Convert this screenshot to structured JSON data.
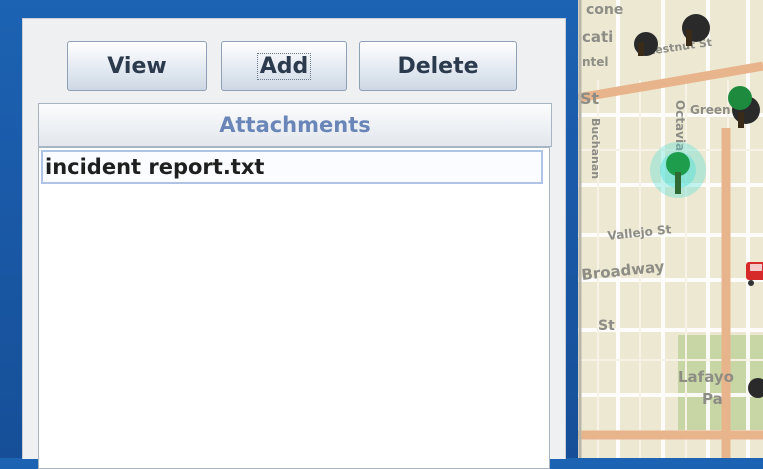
{
  "toolbar": {
    "view_label": "View",
    "add_label": "Add",
    "delete_label": "Delete"
  },
  "attachments": {
    "header": "Attachments",
    "items": [
      {
        "label": "incident report.txt",
        "selected": true
      }
    ]
  },
  "map": {
    "streets": {
      "chestnut": "Chestnut St",
      "green": "Green",
      "octavia": "Octavia",
      "buchanan": "Buchanan",
      "vallejo": "Vallejo St",
      "broadway": "Broadway",
      "pacific_fragment": "St",
      "union_fragment": "St"
    },
    "fragments": {
      "top_1": "cone",
      "top_2": "cati",
      "top_3": "ntel",
      "park_1": "Lafayo",
      "park_2": "Pa"
    },
    "colors": {
      "road_major": "#e8b48c",
      "road_minor": "#ffffff",
      "park": "#c7d6a4",
      "tree_marker": "#1e9e4c",
      "incident_marker": "#d62a2a"
    }
  }
}
